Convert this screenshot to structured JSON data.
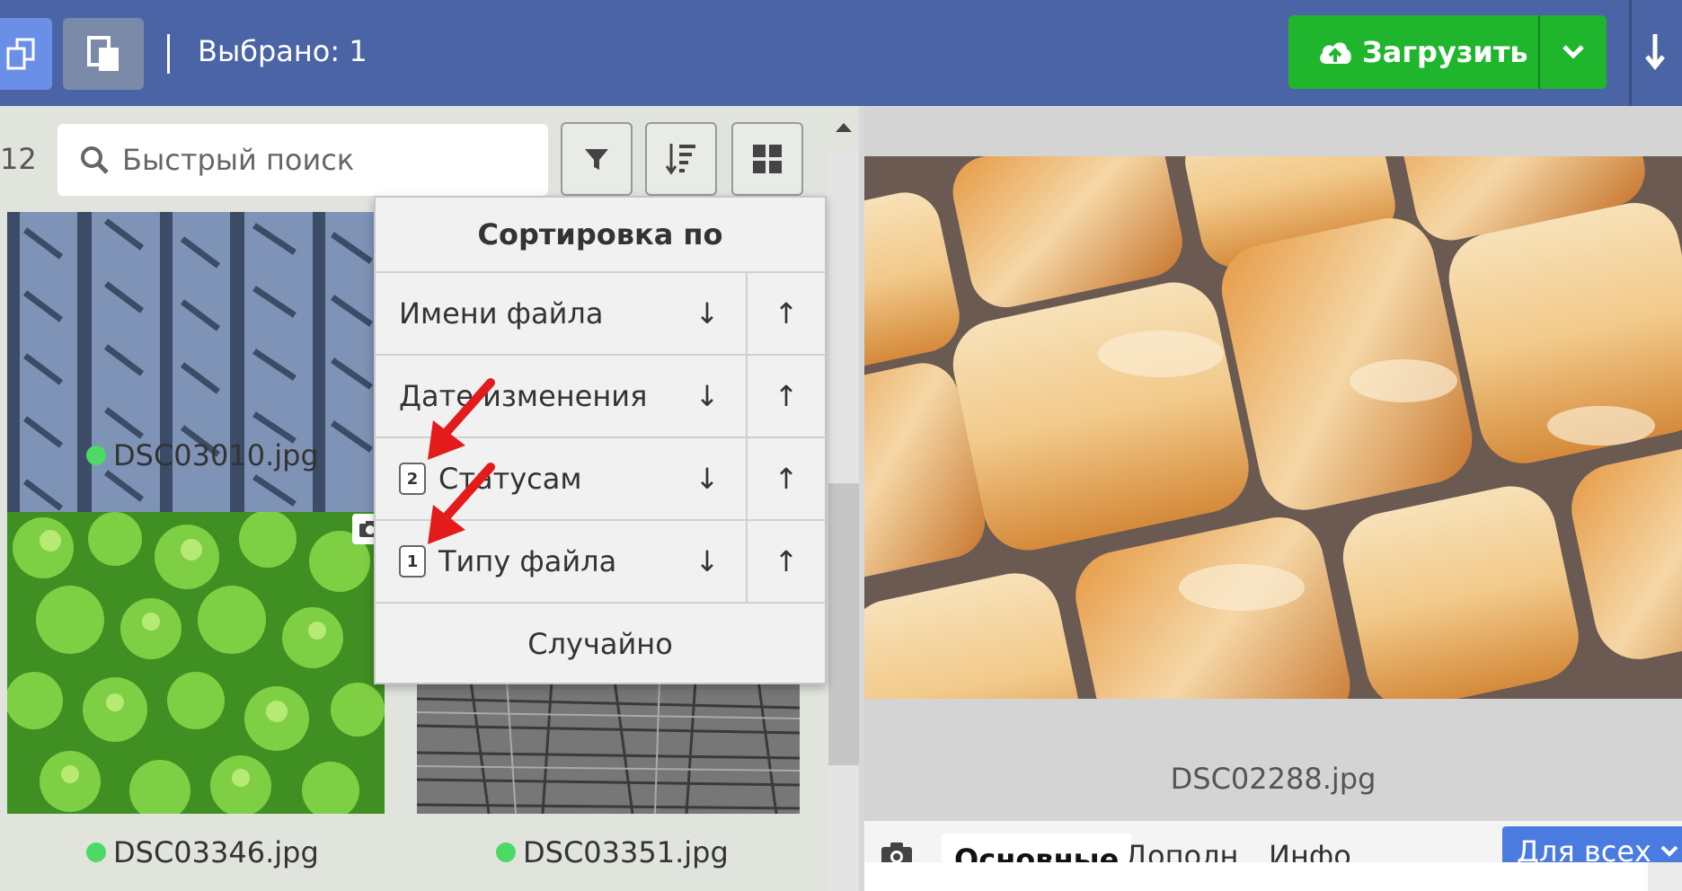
{
  "topbar": {
    "selected_label": "Выбрано: 1",
    "upload_label": "Загрузить",
    "colors": {
      "bar": "#4a64a6",
      "upload": "#1fb52c"
    }
  },
  "left_panel": {
    "count": "12",
    "search": {
      "placeholder": "Быстрый поиск",
      "value": ""
    },
    "thumbnails": [
      {
        "filename": "DSC03010.jpg",
        "status": "green"
      },
      {
        "filename": "DSC03346.jpg",
        "status": "green"
      },
      {
        "filename": "DSC03351.jpg",
        "status": "green"
      }
    ]
  },
  "sort_menu": {
    "title": "Сортировка по",
    "rows": [
      {
        "label": "Имени файла",
        "badge": "",
        "desc": "↓",
        "asc": "↑"
      },
      {
        "label": "Дате изменения",
        "badge": "",
        "desc": "↓",
        "asc": "↑"
      },
      {
        "label": "Статусам",
        "badge": "2",
        "desc": "↓",
        "asc": "↑"
      },
      {
        "label": "Типу файла",
        "badge": "1",
        "desc": "↓",
        "asc": "↑"
      }
    ],
    "random_label": "Случайно"
  },
  "preview": {
    "filename": "DSC02288.jpg"
  },
  "details_tabs": {
    "tabs": [
      "Основные",
      "Дополн.",
      "Инфо"
    ],
    "for_all_label": "Для всех"
  }
}
